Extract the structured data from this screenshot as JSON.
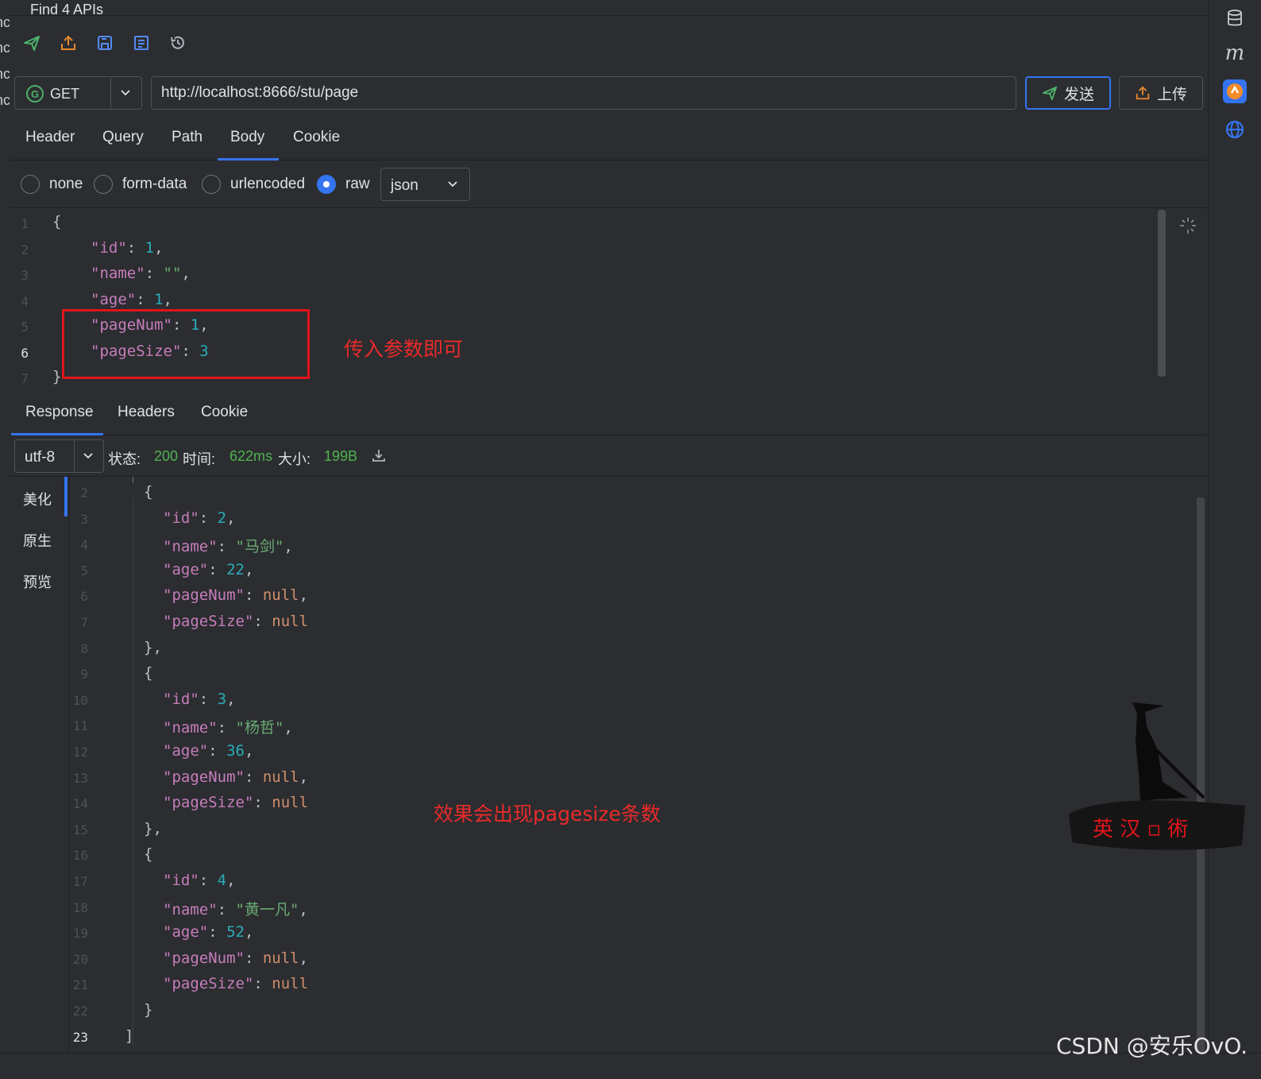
{
  "left_strip": {
    "fragments": [
      "nc",
      "nc",
      "nc",
      "nc"
    ]
  },
  "window": {
    "title": "Find 4 APIs"
  },
  "toolbar": {
    "icons": [
      "send-icon",
      "export-icon",
      "save-icon",
      "save-as-icon",
      "history-icon"
    ]
  },
  "request": {
    "method": "GET",
    "method_badge": "G",
    "url": "http://localhost:8666/stu/page",
    "send_label": "发送",
    "upload_label": "上传"
  },
  "request_tabs": {
    "items": [
      "Header",
      "Query",
      "Path",
      "Body",
      "Cookie"
    ],
    "active": "Body"
  },
  "body_type": {
    "options": [
      "none",
      "form-data",
      "urlencoded",
      "raw"
    ],
    "selected": "raw",
    "format": "json"
  },
  "request_body": {
    "line_numbers": [
      "1",
      "2",
      "3",
      "4",
      "5",
      "6",
      "7"
    ],
    "lines": {
      "l1_open": "{",
      "l2_key": "\"id\"",
      "l2_val": "1",
      "l3_key": "\"name\"",
      "l3_val": "\"\"",
      "l4_key": "\"age\"",
      "l4_val": "1",
      "l5_key": "\"pageNum\"",
      "l5_val": "1",
      "l6_key": "\"pageSize\"",
      "l6_val": "3",
      "l7_close": "}"
    }
  },
  "annotations": {
    "request_note": "传入参数即可",
    "response_note": "效果会出现pagesize条数"
  },
  "response_tabs": {
    "items": [
      "Response",
      "Headers",
      "Cookie"
    ],
    "active": "Response"
  },
  "response_meta": {
    "encoding": "utf-8",
    "status_label": "状态:",
    "status_value": "200",
    "time_label": "时间:",
    "time_value": "622ms",
    "size_label": "大小:",
    "size_value": "199B"
  },
  "response_views": {
    "items": [
      "美化",
      "原生",
      "预览"
    ],
    "active": "美化"
  },
  "response_body": {
    "line_numbers": [
      "2",
      "3",
      "4",
      "5",
      "6",
      "7",
      "8",
      "9",
      "10",
      "11",
      "12",
      "13",
      "14",
      "15",
      "16",
      "17",
      "18",
      "19",
      "20",
      "21",
      "22",
      "23"
    ],
    "records": [
      {
        "id": "2",
        "name": "\"马剑\"",
        "age": "22",
        "pageNum": "null",
        "pageSize": "null"
      },
      {
        "id": "3",
        "name": "\"杨哲\"",
        "age": "36",
        "pageNum": "null",
        "pageSize": "null"
      },
      {
        "id": "4",
        "name": "\"黄一凡\"",
        "age": "52",
        "pageNum": "null",
        "pageSize": "null"
      }
    ],
    "keys": {
      "id": "\"id\"",
      "name": "\"name\"",
      "age": "\"age\"",
      "pageNum": "\"pageNum\"",
      "pageSize": "\"pageSize\""
    },
    "open_brace": "{",
    "close_brace_comma": "},",
    "close_brace": "}",
    "close_bracket": "]"
  },
  "watermark": {
    "logo_text": "英 汉 ▫ 術",
    "credit": "CSDN @安乐OvO."
  },
  "colors": {
    "accent": "#3574f0",
    "annotation_red": "#e0141a",
    "status_green": "#4fb34f",
    "json_key": "#c77dbb",
    "json_number": "#2aacb8",
    "json_string": "#6aab73",
    "json_keyword": "#cf8e6d"
  }
}
